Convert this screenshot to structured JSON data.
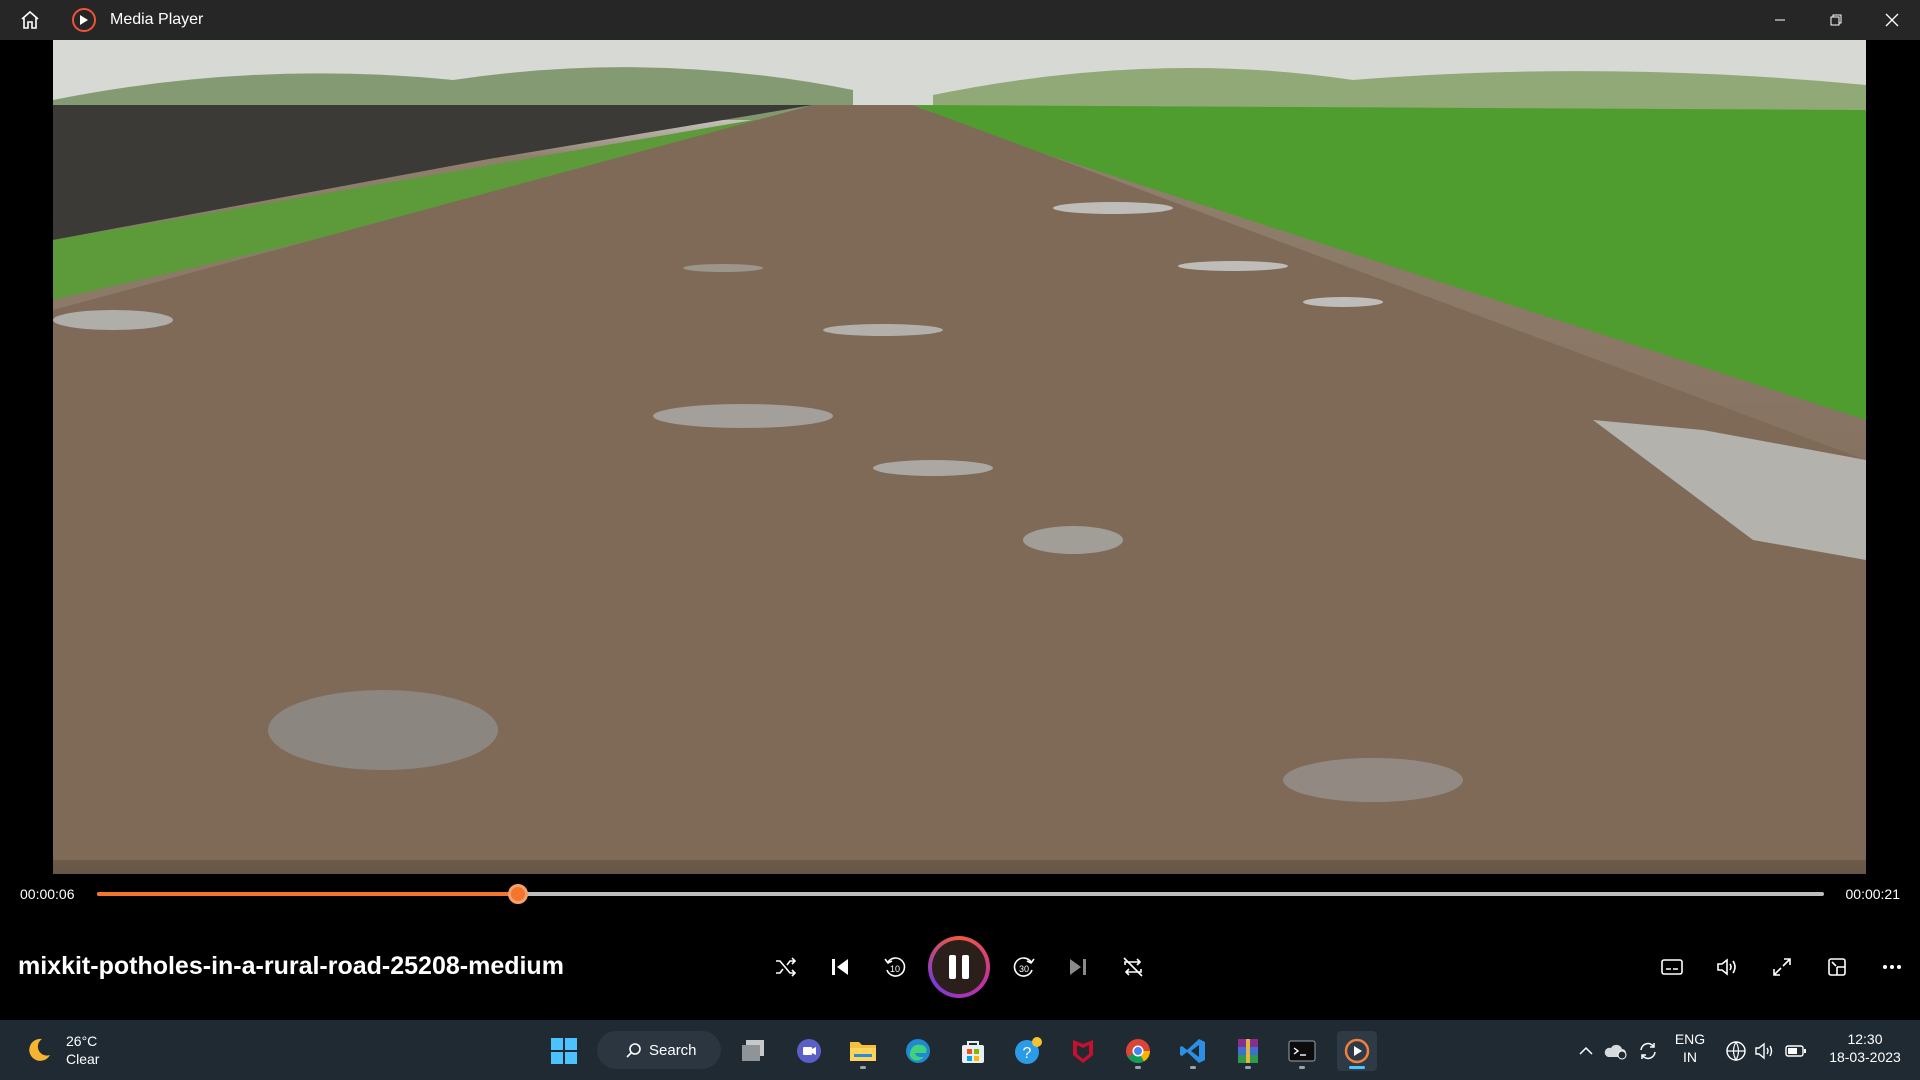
{
  "window": {
    "app_title": "Media Player",
    "icons": {
      "home": "home-icon",
      "minimize": "minimize-icon",
      "restore": "restore-icon",
      "close": "close-icon"
    }
  },
  "video": {
    "title": "mixkit-potholes-in-a-rural-road-25208-medium",
    "current_time": "00:00:06",
    "total_time": "00:00:21",
    "progress_fraction": 0.244
  },
  "controls": {
    "items": [
      "shuffle-icon",
      "previous-icon",
      "rewind-10-icon",
      "pause-icon",
      "forward-30-icon",
      "next-icon",
      "repeat-icon"
    ],
    "rewind_label": "10",
    "forward_label": "30",
    "right_items": [
      "subtitles-icon",
      "volume-icon",
      "fullscreen-icon",
      "mini-player-icon",
      "more-icon"
    ]
  },
  "taskbar": {
    "weather": {
      "temperature": "26°C",
      "condition": "Clear",
      "icon": "moon-icon"
    },
    "search_label": "Search",
    "apps": [
      "windows-start-icon",
      "search-icon",
      "task-view-icon",
      "meet-icon",
      "file-explorer-icon",
      "edge-icon",
      "store-icon",
      "help-icon",
      "mcafee-icon",
      "chrome-icon",
      "vscode-icon",
      "winrar-icon",
      "terminal-icon",
      "media-player-icon"
    ],
    "tray": {
      "language_top": "ENG",
      "language_bottom": "IN",
      "time": "12:30",
      "date": "18-03-2023"
    }
  },
  "colors": {
    "accent": "#f2762e",
    "taskbar": "#1f2a33",
    "titlebar": "#262626"
  }
}
